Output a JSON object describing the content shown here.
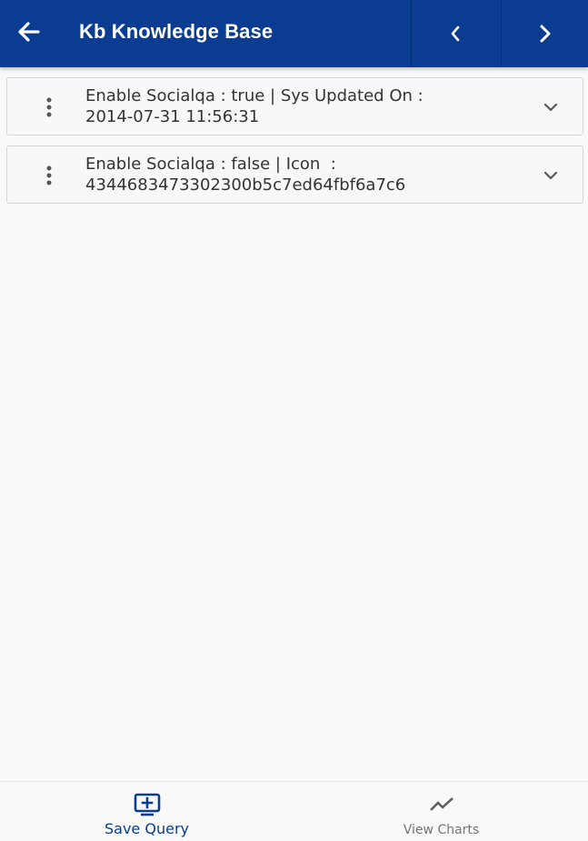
{
  "header": {
    "title": "Kb Knowledge Base",
    "back_icon": "arrow-left-icon",
    "prev_icon": "chevron-left-icon",
    "next_icon": "chevron-right-icon",
    "background_color": "#0a3d91"
  },
  "records": [
    {
      "line1": "Enable Socialqa : true | Sys Updated On :",
      "line2": "2014-07-31 11:56:31"
    },
    {
      "line1": "Enable Socialqa : false | Icon  :",
      "line2": "4344683473302300b5c7ed64fbf6a7c6"
    }
  ],
  "bottom_bar": {
    "save_query_label": "Save Query",
    "view_charts_label": "View Charts",
    "active_color": "#0a3d91",
    "inactive_color": "#757575"
  }
}
